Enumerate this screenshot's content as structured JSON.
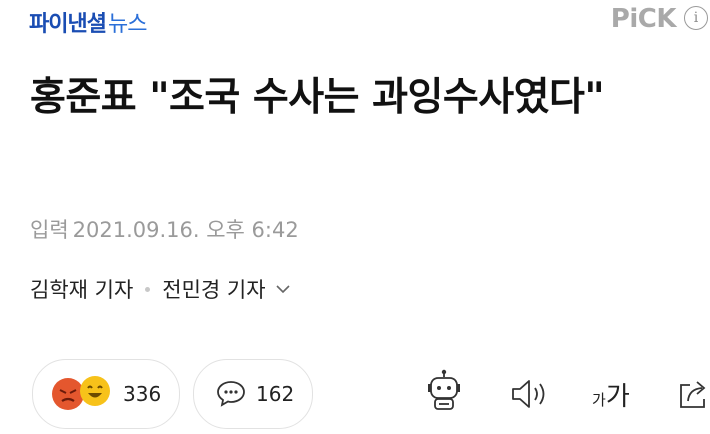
{
  "header": {
    "brand_main": "파이낸셜",
    "brand_sub": "뉴스",
    "pick_label": "PiCK",
    "info_icon": "i"
  },
  "article": {
    "title": "홍준표 \"조국 수사는 과잉수사였다\"",
    "date_label": "입력",
    "date_value": "2021.09.16. 오후 6:42",
    "reporters": [
      "김학재 기자",
      "전민경 기자"
    ]
  },
  "actions": {
    "reaction_count": "336",
    "comment_count": "162",
    "icons": [
      "angry-emoji-icon",
      "laugh-emoji-icon",
      "comment-bubble-icon",
      "robot-summary-icon",
      "speaker-icon",
      "font-size-icon",
      "share-icon"
    ],
    "font_size_small": "가",
    "font_size_large": "가"
  },
  "colors": {
    "brand": "#1a4db3",
    "pick": "#a9a9a9",
    "angry": "#e4572e",
    "laugh": "#f7c21a"
  }
}
